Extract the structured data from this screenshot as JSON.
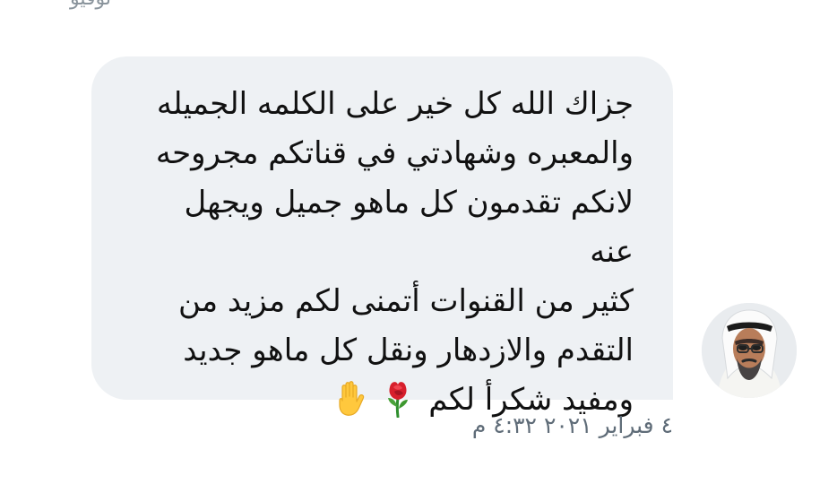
{
  "top_cut_text": "نوفيو",
  "message": {
    "lines": [
      "جزاك الله كل خير على الكلمه الجميله",
      "والمعبره وشهادتي في قناتكم مجروحه",
      "لانكم تقدمون كل ماهو جميل ويجهل عنه",
      "كثير من القنوات أتمنى لكم مزيد من",
      "التقدم والازدهار ونقل كل ماهو جديد",
      "ومفيد شكرأ لكم"
    ],
    "emojis": [
      "rose-icon",
      "raised-hand-icon"
    ]
  },
  "timestamp": "٤ فبراير ٢٠٢١ ٤:٣٢ م",
  "colors": {
    "bubble_background": "#eef1f4",
    "message_text": "#111111",
    "timestamp_text": "#5f6c78"
  }
}
